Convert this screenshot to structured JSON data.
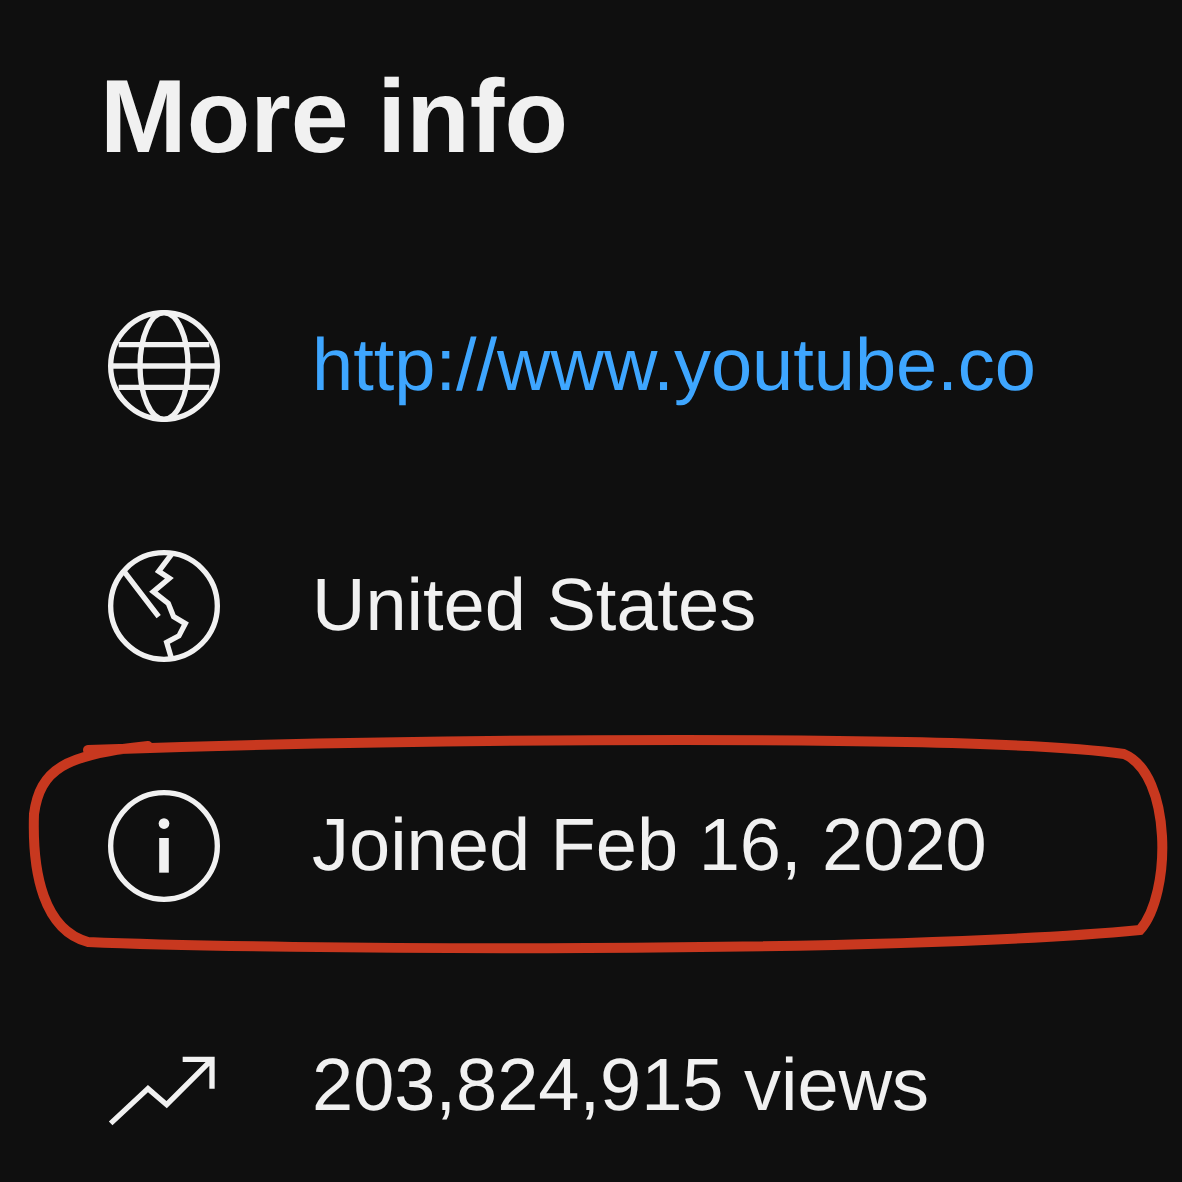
{
  "title": "More info",
  "rows": [
    {
      "kind": "globe",
      "text": "http://www.youtube.co",
      "link": true,
      "circled": false
    },
    {
      "kind": "earth",
      "text": "United States",
      "link": false,
      "circled": false
    },
    {
      "kind": "info",
      "text": "Joined Feb 16, 2020",
      "link": false,
      "circled": true
    },
    {
      "kind": "trend",
      "text": "203,824,915 views",
      "link": false,
      "circled": false
    }
  ]
}
